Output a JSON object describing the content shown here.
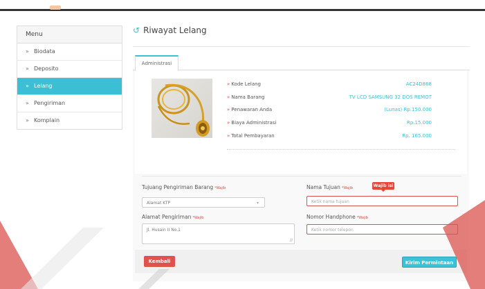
{
  "sidebar": {
    "header": "Menu",
    "items": [
      {
        "label": "Biodata",
        "active": false
      },
      {
        "label": "Deposito",
        "active": false
      },
      {
        "label": "Lelang",
        "active": true
      },
      {
        "label": "Pengiriman",
        "active": false
      },
      {
        "label": "Komplain",
        "active": false
      }
    ]
  },
  "page": {
    "title": "Riwayat Lelang",
    "title_icon": "history-icon",
    "tab": "Administrasi"
  },
  "auction": {
    "rows": [
      {
        "label": "Kode Lelang",
        "value": "AC24D868"
      },
      {
        "label": "Nama Barang",
        "value": "TV LCD SAMSUNG 32 DOS REMOT"
      },
      {
        "label": "Penawaran Anda",
        "value": "(Lunas) Rp.150.000"
      },
      {
        "label": "Biaya Administrasi",
        "value": "Rp.15.000"
      },
      {
        "label": "Total Pembayaran",
        "value": "Rp. 165.000"
      }
    ]
  },
  "form": {
    "tujuan_label": "Tujuang Pengiriman Barang",
    "required": "*Wajib",
    "tujuan_value": "Alamat KTP",
    "alamat_label": "Alamat Pengiriman",
    "alamat_value": "Jl. Husain II No.1",
    "nama_label": "Nama Tujuan",
    "nama_placeholder": "Ketik nama tujuan",
    "hp_label": "Nomor Handphone",
    "hp_placeholder": "Ketik nomor telepon",
    "tooltip": "Wajib isi"
  },
  "buttons": {
    "back": "Kembali",
    "submit": "Kirim Permintaan"
  },
  "colors": {
    "accent": "#3bbfd4",
    "danger": "#e0524d"
  }
}
